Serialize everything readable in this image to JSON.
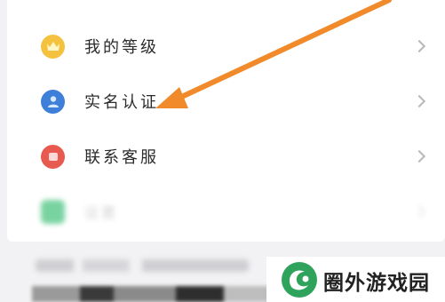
{
  "menu": {
    "items": [
      {
        "label": "我的等级",
        "icon": "crown-icon",
        "icon_color": "#f4c23f"
      },
      {
        "label": "实名认证",
        "icon": "user-id-icon",
        "icon_color": "#3d7fd9"
      },
      {
        "label": "联系客服",
        "icon": "customer-service-icon",
        "icon_color": "#e85a4f"
      },
      {
        "label": "设置",
        "icon": "settings-icon",
        "icon_color": "#58c98a"
      }
    ]
  },
  "annotation": {
    "arrow_color": "#f08a2a"
  },
  "watermark": {
    "text": "圈外游戏园",
    "logo_color": "#2fa35c"
  }
}
